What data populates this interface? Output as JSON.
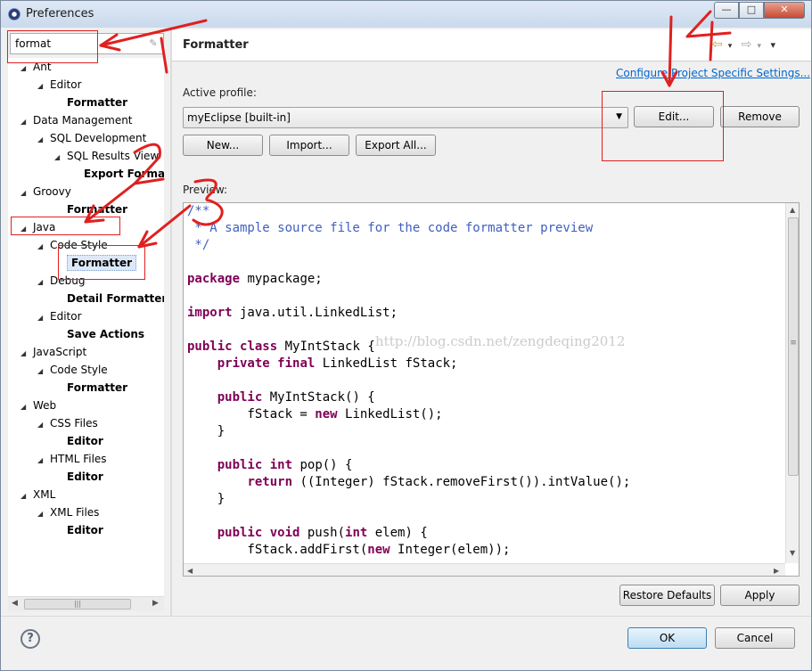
{
  "window": {
    "title": "Preferences",
    "controls": {
      "minimize": "—",
      "maximize": "□",
      "close": "✕"
    }
  },
  "filter": {
    "value": "format",
    "clear_icon": "eraser-icon"
  },
  "tree": {
    "items": [
      {
        "label": "Ant",
        "depth": 0,
        "arrow": "◢",
        "bold": false
      },
      {
        "label": "Editor",
        "depth": 1,
        "arrow": "◢",
        "bold": false
      },
      {
        "label": "Formatter",
        "depth": 2,
        "arrow": "",
        "bold": true
      },
      {
        "label": "Data Management",
        "depth": 0,
        "arrow": "◢",
        "bold": false
      },
      {
        "label": "SQL Development",
        "depth": 1,
        "arrow": "◢",
        "bold": false
      },
      {
        "label": "SQL Results View",
        "depth": 2,
        "arrow": "◢",
        "bold": false
      },
      {
        "label": "Export Format",
        "depth": 3,
        "arrow": "",
        "bold": true
      },
      {
        "label": "Groovy",
        "depth": 0,
        "arrow": "◢",
        "bold": false
      },
      {
        "label": "Formatter",
        "depth": 2,
        "arrow": "",
        "bold": true
      },
      {
        "label": "Java",
        "depth": 0,
        "arrow": "◢",
        "bold": false
      },
      {
        "label": "Code Style",
        "depth": 1,
        "arrow": "◢",
        "bold": false
      },
      {
        "label": "Formatter",
        "depth": 2,
        "arrow": "",
        "bold": true,
        "selected": true
      },
      {
        "label": "Debug",
        "depth": 1,
        "arrow": "◢",
        "bold": false
      },
      {
        "label": "Detail Formatters",
        "depth": 2,
        "arrow": "",
        "bold": true
      },
      {
        "label": "Editor",
        "depth": 1,
        "arrow": "◢",
        "bold": false
      },
      {
        "label": "Save Actions",
        "depth": 2,
        "arrow": "",
        "bold": true
      },
      {
        "label": "JavaScript",
        "depth": 0,
        "arrow": "◢",
        "bold": false
      },
      {
        "label": "Code Style",
        "depth": 1,
        "arrow": "◢",
        "bold": false
      },
      {
        "label": "Formatter",
        "depth": 2,
        "arrow": "",
        "bold": true
      },
      {
        "label": "Web",
        "depth": 0,
        "arrow": "◢",
        "bold": false
      },
      {
        "label": "CSS Files",
        "depth": 1,
        "arrow": "◢",
        "bold": false
      },
      {
        "label": "Editor",
        "depth": 2,
        "arrow": "",
        "bold": true
      },
      {
        "label": "HTML Files",
        "depth": 1,
        "arrow": "◢",
        "bold": false
      },
      {
        "label": "Editor",
        "depth": 2,
        "arrow": "",
        "bold": true
      },
      {
        "label": "XML",
        "depth": 0,
        "arrow": "◢",
        "bold": false
      },
      {
        "label": "XML Files",
        "depth": 1,
        "arrow": "◢",
        "bold": false
      },
      {
        "label": "Editor",
        "depth": 2,
        "arrow": "",
        "bold": true
      }
    ]
  },
  "page": {
    "title": "Formatter",
    "nav": {
      "back_icon": "⇦",
      "forward_icon": "⇨",
      "menu_icon": "▾"
    },
    "project_link": "Configure Project Specific Settings...",
    "active_profile_label": "Active profile:",
    "profile_value": "myEclipse [built-in]",
    "buttons": {
      "edit": "Edit...",
      "remove": "Remove",
      "new": "New...",
      "import": "Import...",
      "export_all": "Export All..."
    },
    "preview_label": "Preview:",
    "watermark": "http://blog.csdn.net/zengdeqing2012"
  },
  "footer": {
    "restore_defaults": "Restore Defaults",
    "apply": "Apply",
    "ok": "OK",
    "cancel": "Cancel",
    "help_icon": "?"
  },
  "annotations": {
    "numbers": [
      "1",
      "2",
      "3",
      "4"
    ]
  },
  "colors": {
    "annotation_red": "#e02020",
    "keyword": "#7f0055",
    "comment": "#3f5fbf",
    "link": "#0066cc"
  }
}
